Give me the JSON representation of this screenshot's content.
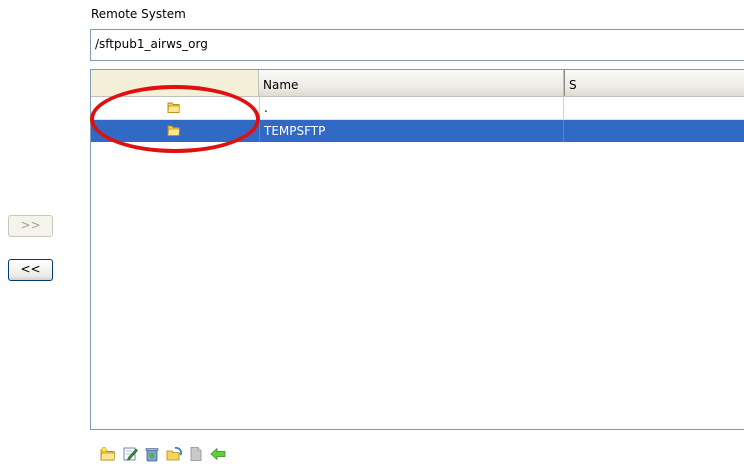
{
  "remote": {
    "label": "Remote System",
    "path": "/sftpub1_airws_org"
  },
  "transfer": {
    "upload_label": ">>",
    "download_label": "<<"
  },
  "table": {
    "columns": [
      "",
      "Name",
      "S"
    ],
    "rows": [
      {
        "icon": "folder-icon",
        "name": ".",
        "selected": false
      },
      {
        "icon": "folder-icon",
        "name": "TEMPSFTP",
        "selected": true
      }
    ]
  },
  "toolbar": {
    "icons": [
      "new-folder-icon",
      "rename-icon",
      "delete-icon",
      "refresh-icon",
      "properties-icon",
      "back-arrow-icon"
    ]
  },
  "colors": {
    "selection": "#316ac5",
    "annotation": "#e01010",
    "border": "#7f9db9"
  }
}
